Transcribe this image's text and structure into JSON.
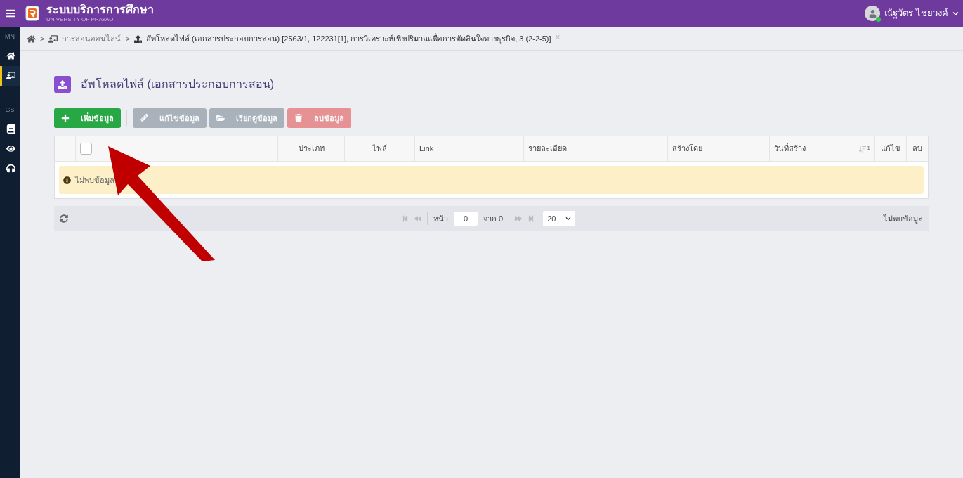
{
  "header": {
    "title": "ระบบบริการการศึกษา",
    "subtitle": "UNIVERSITY OF PHAYAO",
    "user": {
      "name": "ณัฐวัตร ไชยวงค์",
      "online": true
    }
  },
  "sidebar": {
    "items": [
      {
        "kind": "label",
        "text": "MN"
      },
      {
        "kind": "home",
        "selected": false
      },
      {
        "kind": "board",
        "selected": true
      },
      {
        "kind": "label",
        "text": "GS"
      },
      {
        "kind": "book",
        "selected": false
      },
      {
        "kind": "eye",
        "selected": false
      },
      {
        "kind": "headset",
        "selected": false
      }
    ]
  },
  "breadcrumb": {
    "items": [
      {
        "kind": "home"
      },
      {
        "kind": "teach",
        "text": "การสอนออนไลน์"
      },
      {
        "kind": "upload",
        "text": "อัพโหลดไฟล์ (เอกสารประกอบการสอน) [2563/1, 122231[1], การวิเคราะห์เชิงปริมาณเพื่อการตัดสินใจทางธุรกิจ, 3 (2-2-5)]"
      }
    ],
    "separator": ">",
    "close": "×"
  },
  "page_title": "อัพโหลดไฟล์ (เอกสารประกอบการสอน)",
  "toolbar": [
    {
      "kind": "add",
      "label": "เพิ่มข้อมูล",
      "disabled": false
    },
    {
      "kind": "edit",
      "label": "แก้ไขข้อมูล",
      "disabled": true
    },
    {
      "kind": "view",
      "label": "เรียกดูข้อมูล",
      "disabled": true
    },
    {
      "kind": "delete",
      "label": "ลบข้อมูล",
      "disabled": true
    }
  ],
  "table": {
    "select_all": {
      "checked": false
    },
    "columns": [
      {
        "label": "ประเภท"
      },
      {
        "label": "ไฟล์"
      },
      {
        "label": "Link"
      },
      {
        "label": "รายละเอียด"
      },
      {
        "label": "สร้างโดย"
      },
      {
        "label": "วันที่สร้าง",
        "sort": "1"
      },
      {
        "label": "แก้ไข"
      },
      {
        "label": "ลบ"
      }
    ],
    "empty_message": "ไม่พบข้อมูล"
  },
  "pagination": {
    "page_label": "หน้า",
    "page": "0",
    "of": "จาก 0",
    "page_size": "20",
    "status": "ไม่พบข้อมูล"
  }
}
